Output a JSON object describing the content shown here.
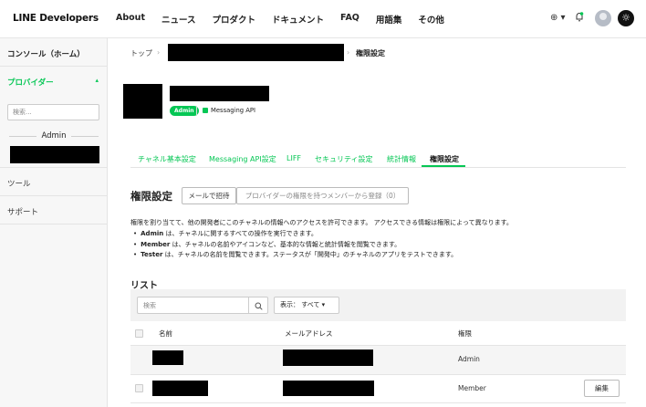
{
  "header": {
    "logo": "LINE Developers",
    "nav": [
      "About",
      "ニュース",
      "プロダクト",
      "ドキュメント",
      "FAQ",
      "用語集",
      "その他"
    ],
    "language_menu": "⊕ ▾",
    "theme_toggle": "☼"
  },
  "sidebar": {
    "console": "コンソール（ホーム）",
    "provider": "プロバイダー",
    "provider_chevron": "▴",
    "search_placeholder": "検索...",
    "role_label": "Admin",
    "tools": "ツール",
    "support": "サポート"
  },
  "breadcrumb": {
    "top": "トップ",
    "separator": "›",
    "current": "権限設定"
  },
  "channel": {
    "role_badge": "Admin",
    "type": "Messaging API"
  },
  "tabs": [
    {
      "label": "チャネル基本設定",
      "active": false
    },
    {
      "label": "Messaging API設定",
      "active": false
    },
    {
      "label": "LIFF",
      "active": false
    },
    {
      "label": "セキュリティ設定",
      "active": false
    },
    {
      "label": "統計情報",
      "active": false
    },
    {
      "label": "権限設定",
      "active": true
    }
  ],
  "permissions": {
    "title": "権限設定",
    "invite_button": "メールで招待",
    "register_button": "プロバイダーの権限を持つメンバーから登録（0）",
    "intro": "権限を割り当てて、他の開発者にこのチャネルの情報へのアクセスを許可できます。 アクセスできる情報は権限によって異なります。",
    "roles": [
      {
        "name": "Admin",
        "text": " は、チャネルに関するすべての操作を実行できます。"
      },
      {
        "name": "Member",
        "text": " は、チャネルの名前やアイコンなど、基本的な情報と統計情報を閲覧できます。"
      },
      {
        "name": "Tester",
        "text": " は、チャネルの名前を閲覧できます。ステータスが「開発中」のチャネルのアプリをテストできます。"
      }
    ]
  },
  "list": {
    "title": "リスト",
    "search_placeholder": "検索",
    "filter_label": "表示： すべて ▾",
    "columns": {
      "name": "名前",
      "email": "メールアドレス",
      "role": "権限"
    },
    "rows": [
      {
        "role": "Admin",
        "action": ""
      },
      {
        "role": "Member",
        "action": "編集"
      }
    ]
  },
  "colors": {
    "accent": "#06c755",
    "redacted": "#000000"
  }
}
